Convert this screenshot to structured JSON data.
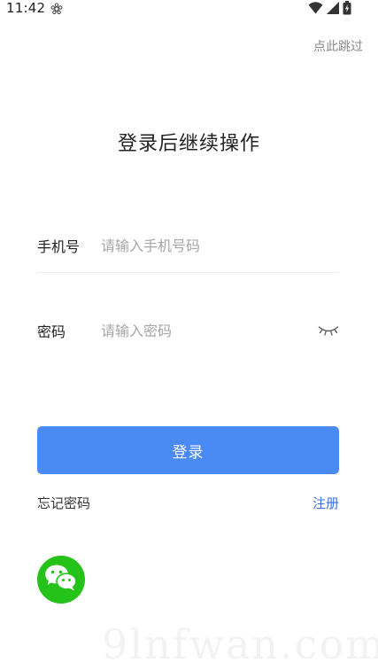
{
  "status_bar": {
    "time": "11:42"
  },
  "header": {
    "skip_label": "点此跳过"
  },
  "title": "登录后继续操作",
  "form": {
    "phone_label": "手机号",
    "phone_placeholder": "请输入手机号码",
    "password_label": "密码",
    "password_placeholder": "请输入密码"
  },
  "login_label": "登录",
  "forgot_label": "忘记密码",
  "register_label": "注册",
  "watermark": "9lnfwan.com",
  "colors": {
    "primary": "#4a8af4",
    "link": "#3a6fd8",
    "wechat": "#25c21a"
  },
  "icons": {
    "status_app": "flower-icon",
    "wifi": "wifi-icon",
    "signal": "signal-icon",
    "battery": "battery-icon",
    "eye": "eye-closed-icon",
    "wechat": "wechat-icon"
  }
}
